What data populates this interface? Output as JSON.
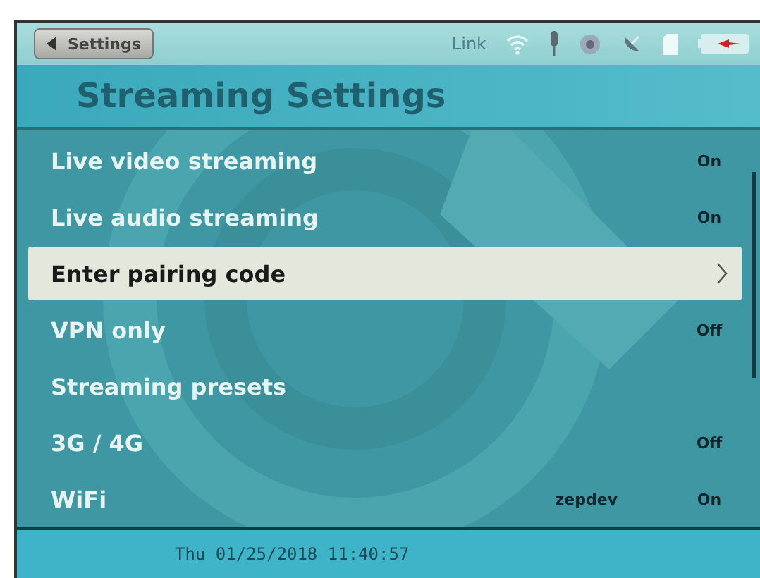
{
  "top_bar": {
    "back_button": "Settings",
    "link_label": "Link"
  },
  "title": "Streaming Settings",
  "items": [
    {
      "label": "Live video streaming",
      "kind": "value",
      "value": "On",
      "selected": false
    },
    {
      "label": "Live audio streaming",
      "kind": "value",
      "value": "On",
      "selected": false
    },
    {
      "label": "Enter pairing code",
      "kind": "submenu",
      "selected": true
    },
    {
      "label": "VPN only",
      "kind": "value",
      "value": "Off",
      "selected": false
    },
    {
      "label": "Streaming presets",
      "kind": "plain",
      "selected": false
    },
    {
      "label": "3G / 4G",
      "kind": "value",
      "value": "Off",
      "selected": false
    },
    {
      "label": "WiFi",
      "kind": "value",
      "detail": "zepdev",
      "value": "On",
      "selected": false
    }
  ],
  "status_bar": "Thu 01/25/2018 11:40:57"
}
